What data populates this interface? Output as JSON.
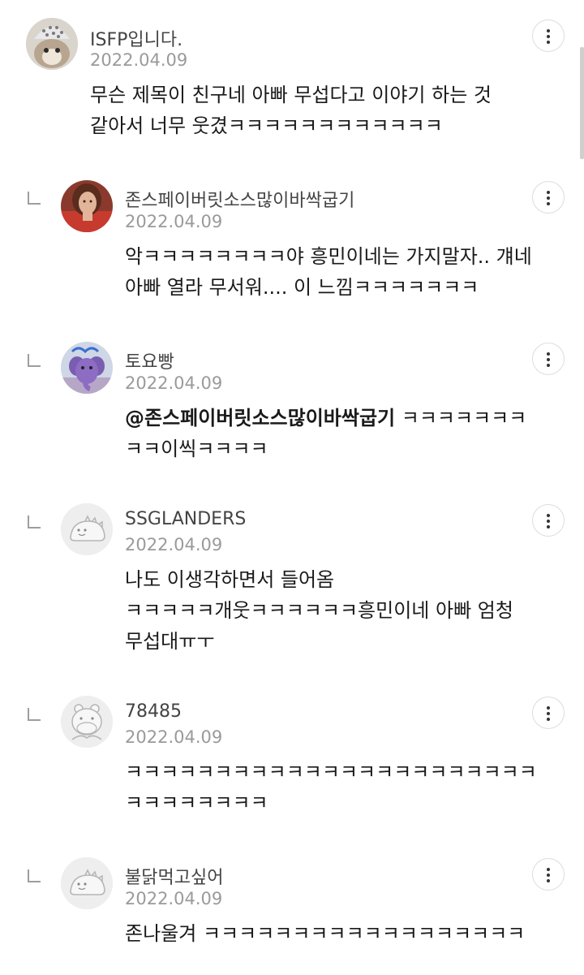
{
  "comments": [
    {
      "author": "ISFP입니다.",
      "date": "2022.04.09",
      "lines": [
        "무슨 제목이 친구네 아빠 무섭다고 이야기 하는 것",
        "같아서 너무 웃겼ㅋㅋㅋㅋㅋㅋㅋㅋㅋㅋㅋㅋ"
      ],
      "is_reply": false,
      "avatar_icon": "cat-with-colander-avatar"
    },
    {
      "author": "존스페이버릿소스많이바싹굽기",
      "date": "2022.04.09",
      "lines": [
        "악ㅋㅋㅋㅋㅋㅋㅋㅋ야 흥민이네는 가지말자.. 걔네",
        "아빠 열라 무서워.... 이 느낌ㅋㅋㅋㅋㅋㅋㅋ"
      ],
      "is_reply": true,
      "avatar_icon": "woman-photo-avatar"
    },
    {
      "author": "토요빵",
      "date": "2022.04.09",
      "mention": "@존스페이버릿소스많이바싹굽기",
      "lines": [
        " ㅋㅋㅋㅋㅋㅋㅋ",
        "ㅋㅋ이씩ㅋㅋㅋㅋ"
      ],
      "is_reply": true,
      "avatar_icon": "purple-elephant-avatar"
    },
    {
      "author": "SSGLANDERS",
      "date": "2022.04.09",
      "lines": [
        "나도 이생각하면서 들어옴",
        "ㅋㅋㅋㅋㅋ개웃ㅋㅋㅋㅋㅋㅋ흥민이네 아빠 엄청",
        "무섭대ㅠㅜ"
      ],
      "is_reply": true,
      "avatar_icon": "dinosaur-default-avatar"
    },
    {
      "author": "78485",
      "date": "2022.04.09",
      "lines": [
        "ㅋㅋㅋㅋㅋㅋㅋㅋㅋㅋㅋㅋㅋㅋㅋㅋㅋㅋㅋㅋㅋㅋㅋ",
        "ㅋㅋㅋㅋㅋㅋㅋㅋ"
      ],
      "is_reply": true,
      "avatar_icon": "hippo-default-avatar"
    },
    {
      "author": "불닭먹고싶어",
      "date": "2022.04.09",
      "lines": [
        "존나울겨 ㅋㅋㅋㅋㅋㅋㅋㅋㅋㅋㅋㅋㅋㅋㅋㅋㅋㅋ"
      ],
      "is_reply": true,
      "avatar_icon": "dinosaur-default-avatar"
    }
  ],
  "more_button_icon": "vertical-dots-icon",
  "reply_icon": "reply-arrow-icon"
}
